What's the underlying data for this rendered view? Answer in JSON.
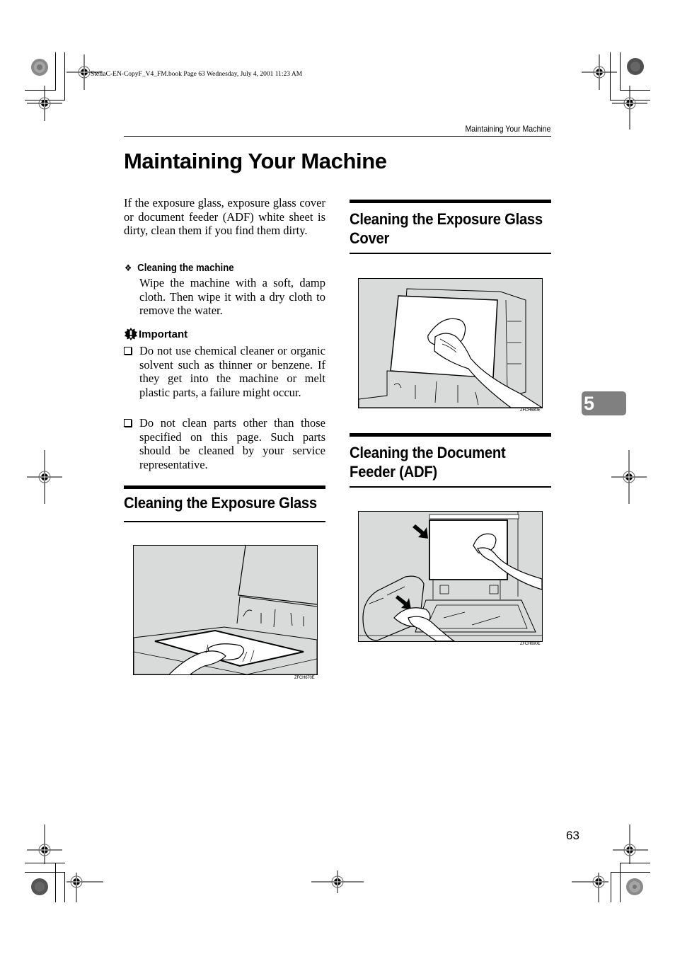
{
  "print_marks": {
    "book_info": "StellaC-EN-CopyF_V4_FM.book  Page 63  Wednesday, July 4, 2001  11:23 AM"
  },
  "header": {
    "running_head": "Maintaining Your Machine"
  },
  "page_title": "Maintaining Your Machine",
  "left_column": {
    "intro": "If the exposure glass, exposure glass cover or document feeder (ADF) white sheet is dirty, clean them if you find them dirty.",
    "cleaning_machine": {
      "bullet_icon": "diamond-bullet-icon",
      "heading": "Cleaning the machine",
      "body": "Wipe the machine with a soft, damp cloth. Then wipe it with a dry cloth to remove the water."
    },
    "important": {
      "icon": "important-icon",
      "label": "Important",
      "items": [
        "Do not use chemical cleaner or organic solvent such as thinner or benzene. If they get into the machine or melt plastic parts, a failure might occur.",
        "Do not clean parts other than those specified on this page. Such parts should be cleaned by your service representative."
      ]
    },
    "section_exposure_glass": {
      "heading": "Cleaning the Exposure Glass",
      "figure_code": "ZFCH670E"
    }
  },
  "right_column": {
    "section_glass_cover": {
      "heading": "Cleaning the Exposure Glass Cover",
      "figure_code": "ZFCH680E"
    },
    "section_adf": {
      "heading": "Cleaning the Document Feeder (ADF)",
      "figure_code": "ZFCH690E"
    }
  },
  "chapter_tab": "5",
  "page_number": "63",
  "colors": {
    "chapter_tab_bg": "#808080",
    "illustration_bg": "#d9dada"
  }
}
